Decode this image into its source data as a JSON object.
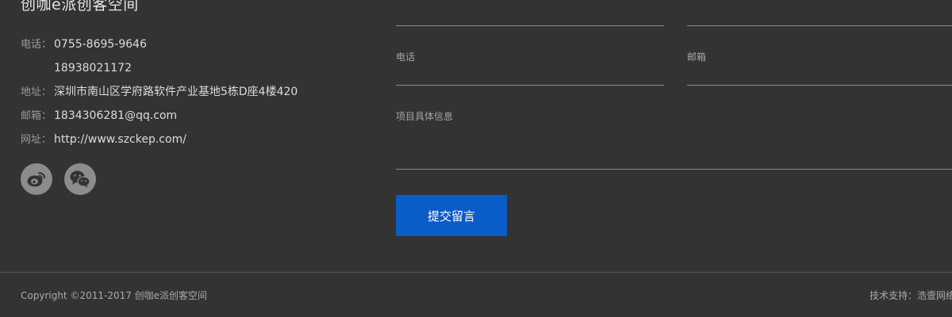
{
  "company": {
    "name": "创咖e派创客空间"
  },
  "contact": {
    "phone_label": "电话：",
    "phone_1": "0755-8695-9646",
    "phone_2": "18938021172",
    "address_label": "地址：",
    "address": "深圳市南山区学府路软件产业基地5栋D座4楼420",
    "email_label": "邮箱：",
    "email": "1834306281@qq.com",
    "website_label": "网址：",
    "website": "http://www.szckep.com/"
  },
  "social": {
    "weibo_icon": "weibo-icon",
    "wechat_icon": "wechat-icon"
  },
  "form": {
    "phone_label": "电话",
    "email_label": "邮箱",
    "details_label": "项目具体信息",
    "submit_label": "提交留言"
  },
  "footer": {
    "copyright": "Copyright ©2011-2017 创咖e派创客空间",
    "tech_support": "技术支持：浩壹网络"
  },
  "colors": {
    "background": "#333333",
    "accent": "#0a5cc8",
    "icon_circle": "#8c8c8c"
  }
}
